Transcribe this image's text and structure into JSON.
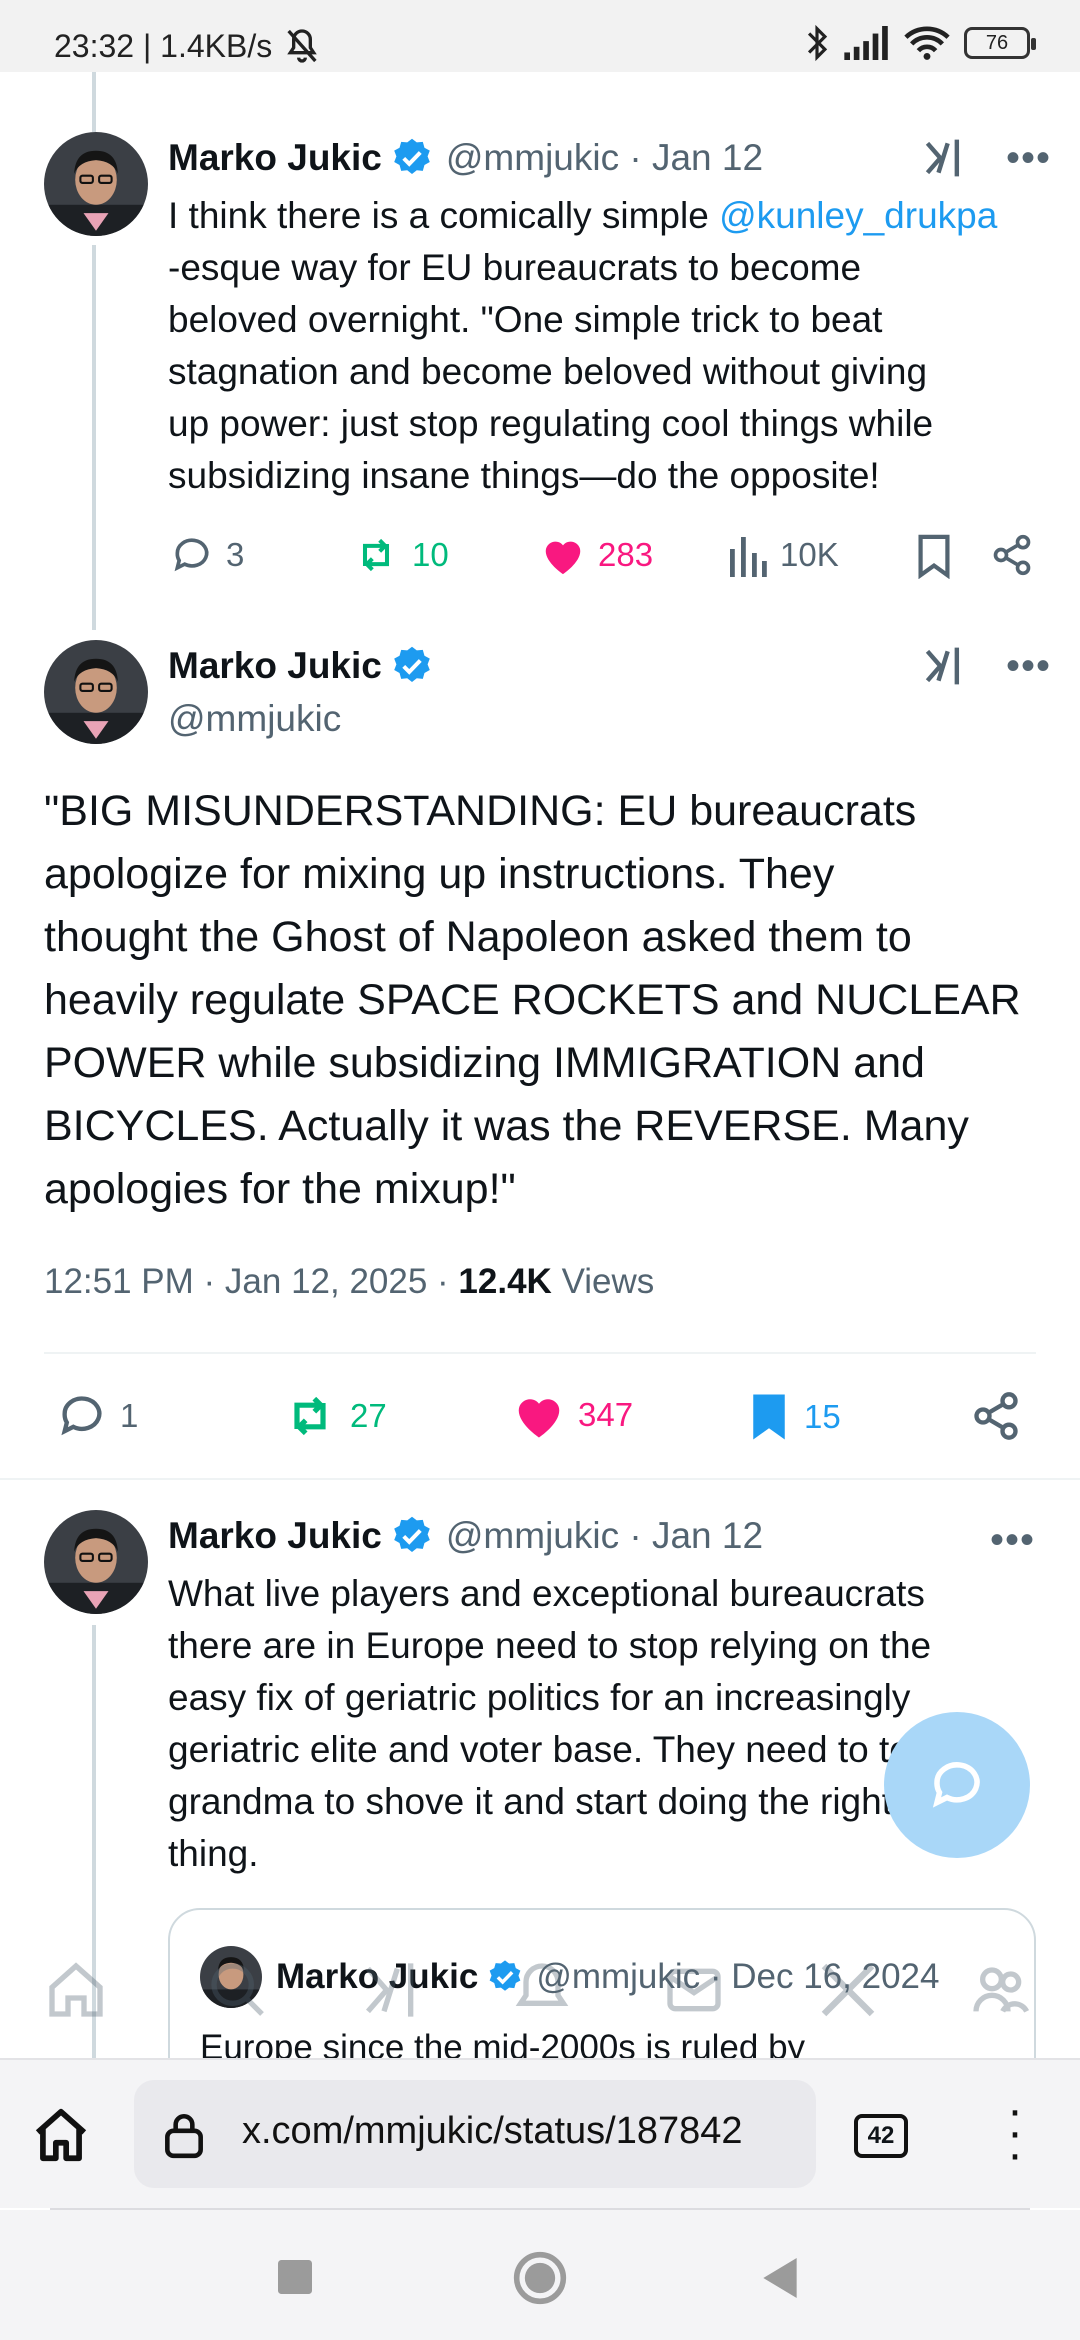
{
  "status_bar": {
    "time_speed": "23:32 | 1.4KB/s",
    "battery": "76"
  },
  "tweet1": {
    "name": "Marko Jukic",
    "handle_date": "@mmjukic · Jan 12",
    "text_lines": [
      "I think there is a comically simple ",
      "-esque way for EU bureaucrats to become",
      "beloved overnight. \"One simple trick to beat",
      "stagnation and become beloved without giving",
      "up power: just stop regulating cool things while",
      "subsidizing insane things—do the opposite!"
    ],
    "mention": "@kunley_drukpa",
    "replies": "3",
    "reposts": "10",
    "likes": "283",
    "views": "10K"
  },
  "main_tweet": {
    "name": "Marko Jukic",
    "handle": "@mmjukic",
    "text_lines": [
      "\"BIG MISUNDERSTANDING: EU bureaucrats",
      "apologize for mixing up instructions. They",
      "thought the Ghost of Napoleon asked them to",
      "heavily regulate SPACE ROCKETS and NUCLEAR",
      "POWER while subsidizing IMMIGRATION and",
      "BICYCLES. Actually it was the REVERSE. Many",
      "apologies for the mixup!\""
    ],
    "timestamp": "12:51 PM · Jan 12, 2025 · ",
    "views_count": "12.4K",
    "views_label": "Views",
    "replies": "1",
    "reposts": "27",
    "likes": "347",
    "bookmarks": "15"
  },
  "tweet3": {
    "name": "Marko Jukic",
    "handle_date": "@mmjukic · Jan 12",
    "text_lines": [
      "What live players and exceptional bureaucrats",
      "there are in Europe need to stop relying on the",
      "easy fix of geriatric politics for an increasingly",
      "geriatric elite and voter base. They need to tell",
      "grandma to shove it and start doing the right",
      "thing."
    ]
  },
  "quote": {
    "name": "Marko Jukic",
    "handle_date": "@mmjukic · Dec 16, 2024",
    "text": "Europe since the mid-2000s is ruled by"
  },
  "browser": {
    "url": "x.com/mmjukic/status/187842",
    "tab_count": "42"
  },
  "colors": {
    "accent_blue": "#1d9bf0",
    "repost_green": "#00ba7c",
    "like_pink": "#f91880",
    "muted": "#536471"
  }
}
